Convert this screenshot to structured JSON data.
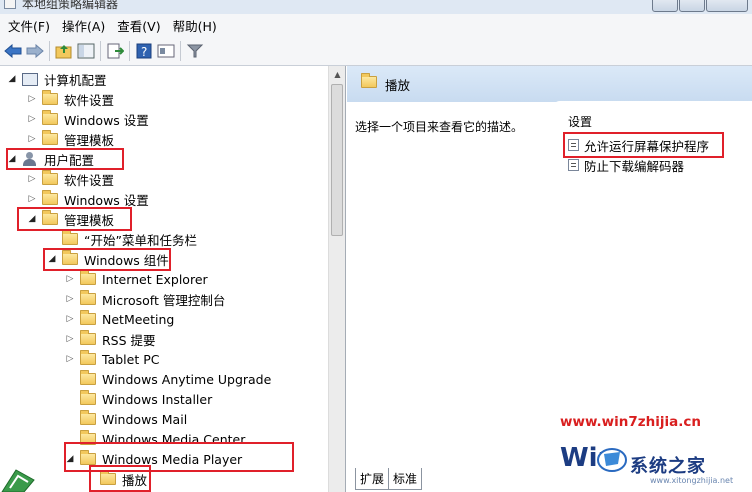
{
  "window": {
    "title": "本地组策略编辑器"
  },
  "menu": [
    "文件(F)",
    "操作(A)",
    "查看(V)",
    "帮助(H)"
  ],
  "toolbar": [
    "back-icon",
    "forward-icon",
    "up-folder-icon",
    "show-hide-tree-icon",
    "export-list-icon",
    "help-icon",
    "properties-icon",
    "filter-icon"
  ],
  "tree": {
    "computer_config": "计算机配置",
    "cc_software": "软件设置",
    "cc_windows": "Windows 设置",
    "cc_admin": "管理模板",
    "user_config": "用户配置",
    "uc_software": "软件设置",
    "uc_windows": "Windows 设置",
    "uc_admin": "管理模板",
    "start_menu": "“开始”菜单和任务栏",
    "win_components": "Windows 组件",
    "components": [
      "Internet Explorer",
      "Microsoft 管理控制台",
      "NetMeeting",
      "RSS 提要",
      "Tablet PC",
      "Windows Anytime Upgrade",
      "Windows Installer",
      "Windows Mail",
      "Windows Media Center",
      "Windows Media Player"
    ],
    "playback": "播放"
  },
  "details": {
    "header_title": "播放",
    "description": "选择一个项目来查看它的描述。",
    "column_label": "设置",
    "settings": [
      "允许运行屏幕保护程序",
      "防止下载编解码器"
    ]
  },
  "tabs": [
    "扩展",
    "标准"
  ],
  "watermark": {
    "url": "www.win7zhijia.cn",
    "brand": "系统之家",
    "sub": "www.xitongzhijia.net"
  },
  "colors": {
    "highlight_box": "#e0202a",
    "header_bg": "#c8dbf0",
    "watermark_red": "#d91f1f"
  }
}
